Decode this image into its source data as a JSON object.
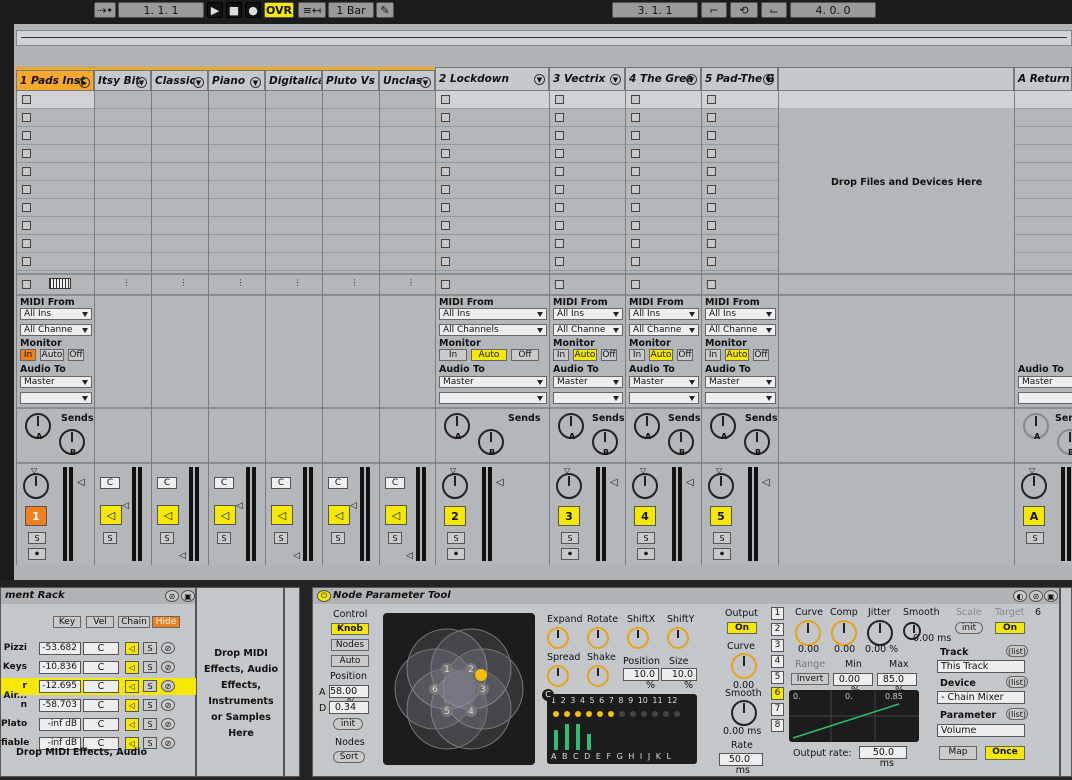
{
  "transport": {
    "nudge": "⇢•",
    "position": "1.  1.  1",
    "overdub": "OVR",
    "quantize": "1 Bar",
    "loop_start": "3.  1.  1",
    "loop_length": "4.  0.  0"
  },
  "session": {
    "drop_hint": "Drop Files and Devices Here",
    "tracks": [
      {
        "name": "1 Pads Inst",
        "num": "1"
      },
      {
        "name": "Itsy Bit"
      },
      {
        "name": "Classic"
      },
      {
        "name": "Piano"
      },
      {
        "name": "Digitalica"
      },
      {
        "name": "Pluto Vs"
      },
      {
        "name": "Unclas"
      },
      {
        "name": "2 Lockdown",
        "num": "2"
      },
      {
        "name": "3 Vectrix",
        "num": "3"
      },
      {
        "name": "4 The Grea",
        "num": "4"
      },
      {
        "name": "5 Pad-The G",
        "num": "5"
      },
      {
        "name": "A Return",
        "num": "A"
      }
    ],
    "io": {
      "midi_from": "MIDI From",
      "all_ins": "All Ins",
      "all_channels": "All Channels",
      "all_channe": "All Channe",
      "monitor": "Monitor",
      "in": "In",
      "auto": "Auto",
      "off": "Off",
      "audio_to": "Audio To",
      "master": "Master",
      "sends": "Sends",
      "sen": "Sen",
      "a": "A",
      "b": "B",
      "s": "S",
      "c": "C"
    }
  },
  "rack": {
    "title": "ment Rack",
    "key": "Key",
    "vel": "Vel",
    "chain": "Chain",
    "hide": "Hide",
    "drop": "Drop MIDI Effects, Audio Effects, Instruments or Samples Here",
    "drop2": "Drop MIDI Effects, Audio",
    "chains": [
      {
        "name": "Pizzi",
        "vol": "-53.682"
      },
      {
        "name": "Keys",
        "vol": "-10.836"
      },
      {
        "name": "r Air...",
        "vol": "-12.695"
      },
      {
        "name": "n",
        "vol": "-58.703"
      },
      {
        "name": "Plato",
        "vol": "-inf dB"
      },
      {
        "name": "fiable",
        "vol": "-inf dB"
      }
    ]
  },
  "npt": {
    "title": "Node Parameter Tool",
    "control": "Control",
    "knob": "Knob",
    "nodes": "Nodes",
    "auto": "Auto",
    "position": "Position",
    "a_label": "A",
    "a_val": "58.00 %",
    "d_label": "D",
    "d_val": "0.34",
    "init": "init",
    "nodes_lbl": "Nodes",
    "sort": "Sort",
    "expand": "Expand",
    "rotate": "Rotate",
    "shiftx": "ShiftX",
    "shifty": "ShiftY",
    "spread": "Spread",
    "shake": "Shake",
    "pos_lbl": "Position",
    "size_lbl": "Size",
    "pos_val": "10.0 %",
    "size_val": "10.0 %",
    "c_lbl": "C",
    "cols": "1 2 3 4 5 6 7 8 9 10 11 12",
    "letters": "A B C D E F G H I J K L",
    "output": "Output",
    "on": "On",
    "curve": "Curve",
    "curve_val": "0.00",
    "smooth": "Smooth",
    "smooth_val": "0.00 ms",
    "rate": "Rate",
    "rate_val": "50.0 ms",
    "curve2": "Curve",
    "comp": "Comp",
    "jitter": "Jitter",
    "smooth2": "Smooth",
    "scale": "Scale",
    "target": "Target",
    "six": "6",
    "v1": "0.00",
    "v2": "0.00",
    "v3": "0.00 %",
    "v4": "0.00 ms",
    "init2": "init",
    "on2": "On",
    "range": "Range",
    "min": "Min",
    "max": "Max",
    "invert": "Invert",
    "min_val": "0.00 %",
    "max_val": "85.0 %",
    "g1": "0.",
    "g2": "0.",
    "g3": "0.85",
    "track": "Track",
    "list": "(list)",
    "this_track": "This Track",
    "device": "Device",
    "chain_mixer": "- Chain Mixer",
    "parameter": "Parameter",
    "volume": "Volume",
    "map": "Map",
    "once": "Once",
    "out_rate": "Output rate:",
    "out_rate_val": "50.0 ms"
  }
}
